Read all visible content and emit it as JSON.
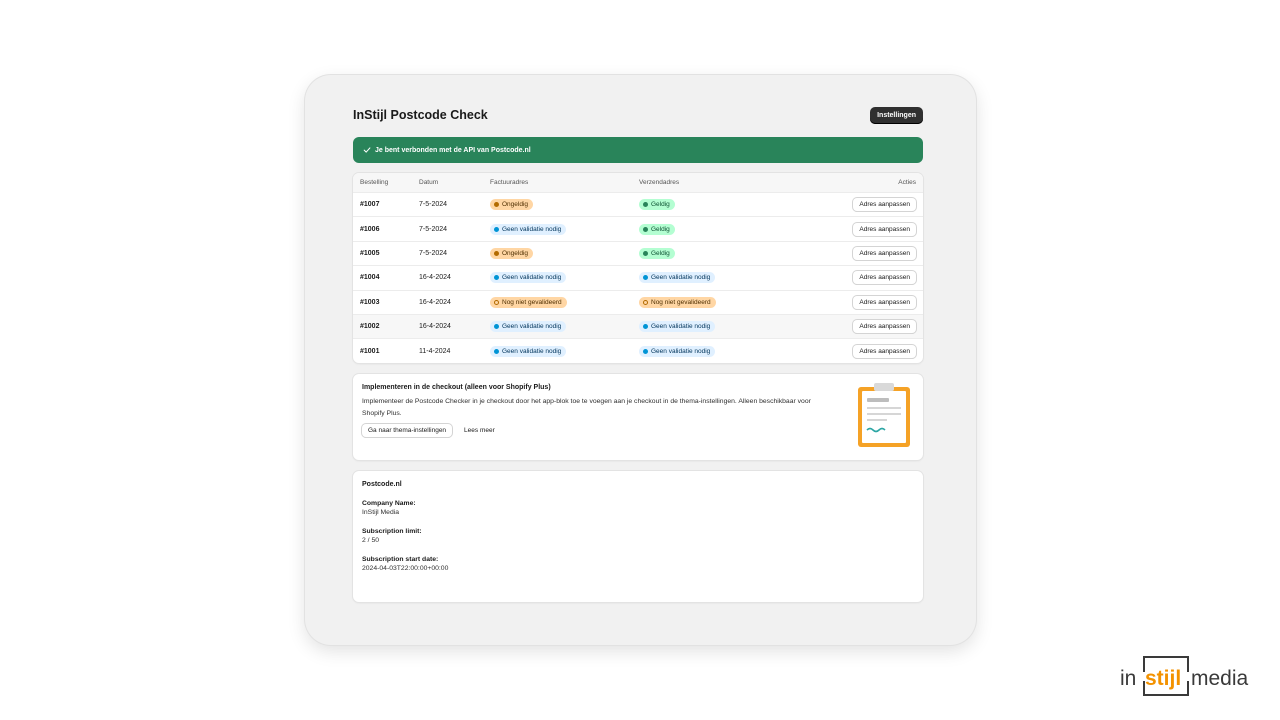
{
  "header": {
    "title": "InStijl Postcode Check",
    "settings_label": "Instellingen"
  },
  "banner": {
    "text": "Je bent verbonden met de API van Postcode.nl"
  },
  "table": {
    "headers": [
      "Bestelling",
      "Datum",
      "Factuuradres",
      "Verzendadres",
      "Acties"
    ],
    "rows": [
      {
        "order": "#1007",
        "date": "7-5-2024",
        "billing": "Ongeldig",
        "shipping": "Geldig",
        "action": "Adres aanpassen"
      },
      {
        "order": "#1006",
        "date": "7-5-2024",
        "billing": "Geen validatie nodig",
        "shipping": "Geldig",
        "action": "Adres aanpassen"
      },
      {
        "order": "#1005",
        "date": "7-5-2024",
        "billing": "Ongeldig",
        "shipping": "Geldig",
        "action": "Adres aanpassen"
      },
      {
        "order": "#1004",
        "date": "16-4-2024",
        "billing": "Geen validatie nodig",
        "shipping": "Geen validatie nodig",
        "action": "Adres aanpassen"
      },
      {
        "order": "#1003",
        "date": "16-4-2024",
        "billing": "Nog niet gevalideerd",
        "shipping": "Nog niet gevalideerd",
        "action": "Adres aanpassen"
      },
      {
        "order": "#1002",
        "date": "16-4-2024",
        "billing": "Geen validatie nodig",
        "shipping": "Geen validatie nodig",
        "action": "Adres aanpassen"
      },
      {
        "order": "#1001",
        "date": "11-4-2024",
        "billing": "Geen validatie nodig",
        "shipping": "Geen validatie nodig",
        "action": "Adres aanpassen"
      }
    ]
  },
  "checkout": {
    "title": "Implementeren in de checkout (alleen voor Shopify Plus)",
    "text": "Implementeer de Postcode Checker in je checkout door het app-blok toe te voegen aan je checkout in de thema-instellingen. Alleen beschikbaar voor Shopify Plus.",
    "primary_label": "Ga naar thema-instellingen",
    "secondary_label": "Lees meer"
  },
  "postcode": {
    "title": "Postcode.nl",
    "company_label": "Company Name:",
    "company_value": "InStijl Media",
    "limit_label": "Subscription limit:",
    "limit_value": "2 / 50",
    "start_label": "Subscription start date:",
    "start_value": "2024-04-03T22:00:00+00:00"
  },
  "logo": {
    "part1": "in",
    "part2": "stijl",
    "part3": "media"
  },
  "colors": {
    "success": "#29845a",
    "accent_orange": "#f39200",
    "dark_button": "#303030"
  }
}
